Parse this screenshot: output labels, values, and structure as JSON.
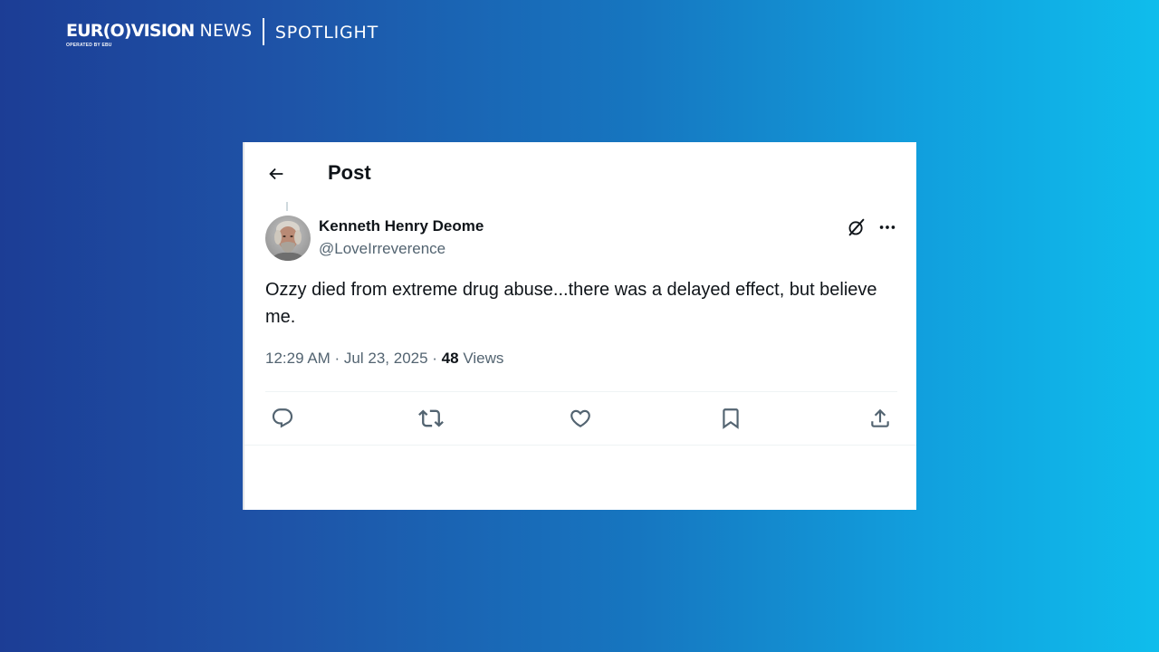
{
  "brand": {
    "logo_main": "EUR(O)VISION",
    "logo_news": "NEWS",
    "operated_by": "OPERATED BY EBU",
    "section": "SPOTLIGHT"
  },
  "post": {
    "header_title": "Post",
    "author": {
      "name": "Kenneth Henry Deome",
      "handle": "@LoveIrreverence"
    },
    "text": "Ozzy died from extreme drug abuse...there was a delayed effect, but believe me.",
    "timestamp": "12:29 AM · Jul 23, 2025 · ",
    "views_count": "48",
    "views_label": " Views"
  },
  "icons": {
    "back": "arrow-left-icon",
    "grok": "grok-icon",
    "more": "more-horizontal-icon",
    "reply": "reply-icon",
    "repost": "repost-icon",
    "like": "heart-icon",
    "bookmark": "bookmark-icon",
    "share": "share-icon"
  },
  "colors": {
    "text_primary": "#0f1419",
    "text_secondary": "#536471",
    "gradient_start": "#1c3d95",
    "gradient_end": "#0fbdec"
  }
}
